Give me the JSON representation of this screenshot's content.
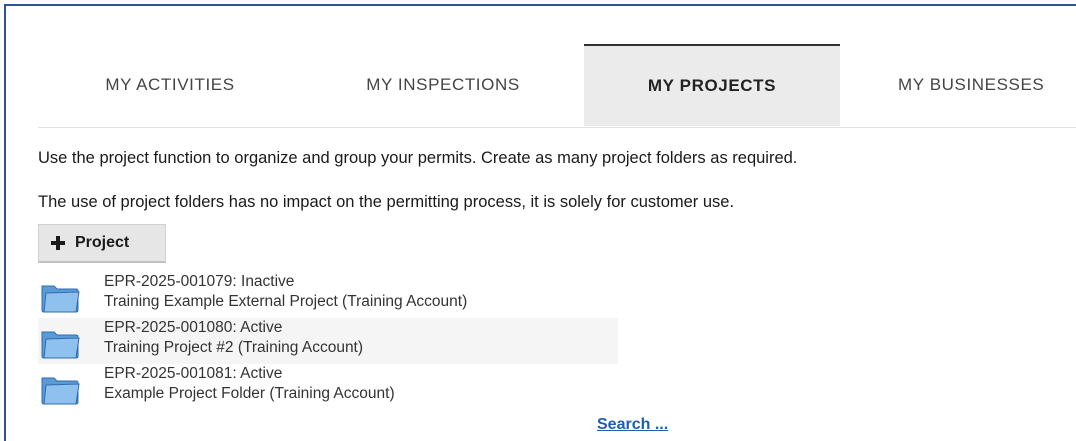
{
  "tabs": [
    {
      "label": "MY ACTIVITIES",
      "active": false
    },
    {
      "label": "MY INSPECTIONS",
      "active": false
    },
    {
      "label": "MY PROJECTS",
      "active": true
    },
    {
      "label": "MY BUSINESSES",
      "active": false
    }
  ],
  "intro": {
    "line1": "Use the project function to organize and group your permits. Create as many project folders as required.",
    "line2": "The use of project folders has no impact on the permitting process, it is solely for customer use."
  },
  "add_project_button": {
    "label": "Project",
    "icon": "plus-icon"
  },
  "projects": [
    {
      "id_status": "EPR-2025-001079: Inactive",
      "name": "Training Example External Project (Training Account)",
      "icon": "folder-icon"
    },
    {
      "id_status": "EPR-2025-001080: Active",
      "name": "Training Project #2 (Training Account)",
      "icon": "folder-icon"
    },
    {
      "id_status": "EPR-2025-001081: Active",
      "name": "Example Project Folder (Training Account)",
      "icon": "folder-icon"
    }
  ],
  "search_link": "Search ...",
  "colors": {
    "frame_border": "#2f5496",
    "active_tab_bg": "#ebebeb",
    "link": "#1f5fad",
    "folder_blue": "#4a90d9"
  }
}
